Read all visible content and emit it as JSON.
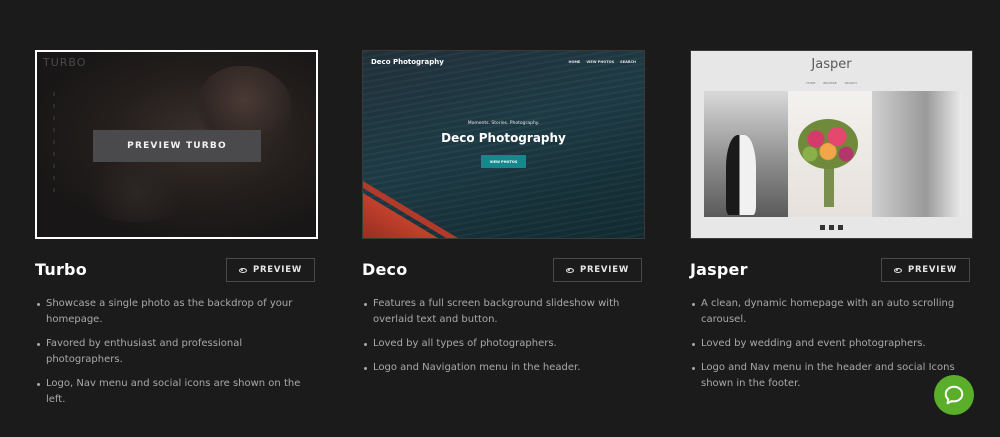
{
  "cards": [
    {
      "title": "Turbo",
      "preview_label": "PREVIEW",
      "thumb": {
        "logo": "TURBO",
        "overlay_button": "PREVIEW TURBO"
      },
      "features": [
        "Showcase a single photo as the backdrop of your homepage.",
        "Favored by enthusiast and professional photographers.",
        "Logo, Nav menu and social icons are shown on the left."
      ]
    },
    {
      "title": "Deco",
      "preview_label": "PREVIEW",
      "thumb": {
        "brand": "Deco Photography",
        "nav": [
          "HOME",
          "VIEW PHOTOS",
          "SEARCH"
        ],
        "tagline": "Moments. Stories. Photography.",
        "headline": "Deco Photography",
        "cta": "VIEW PHOTOS"
      },
      "features": [
        "Features a full screen background slideshow with overlaid text and button.",
        "Loved by all types of photographers.",
        "Logo and Navigation menu in the header."
      ]
    },
    {
      "title": "Jasper",
      "preview_label": "PREVIEW",
      "thumb": {
        "logo": "Jasper",
        "nav": [
          "HOME",
          "BROWSE",
          "SEARCH"
        ]
      },
      "features": [
        "A clean, dynamic homepage with an auto scrolling carousel.",
        "Loved by wedding and event photographers.",
        "Logo and Nav menu in the header and social Icons shown in the footer."
      ]
    }
  ],
  "colors": {
    "background": "#1b1b1c",
    "chat_button": "#5bae2a",
    "deco_cta": "#16878c"
  },
  "icons": {
    "preview": "eye-icon",
    "chat": "chat-bubble-icon"
  }
}
